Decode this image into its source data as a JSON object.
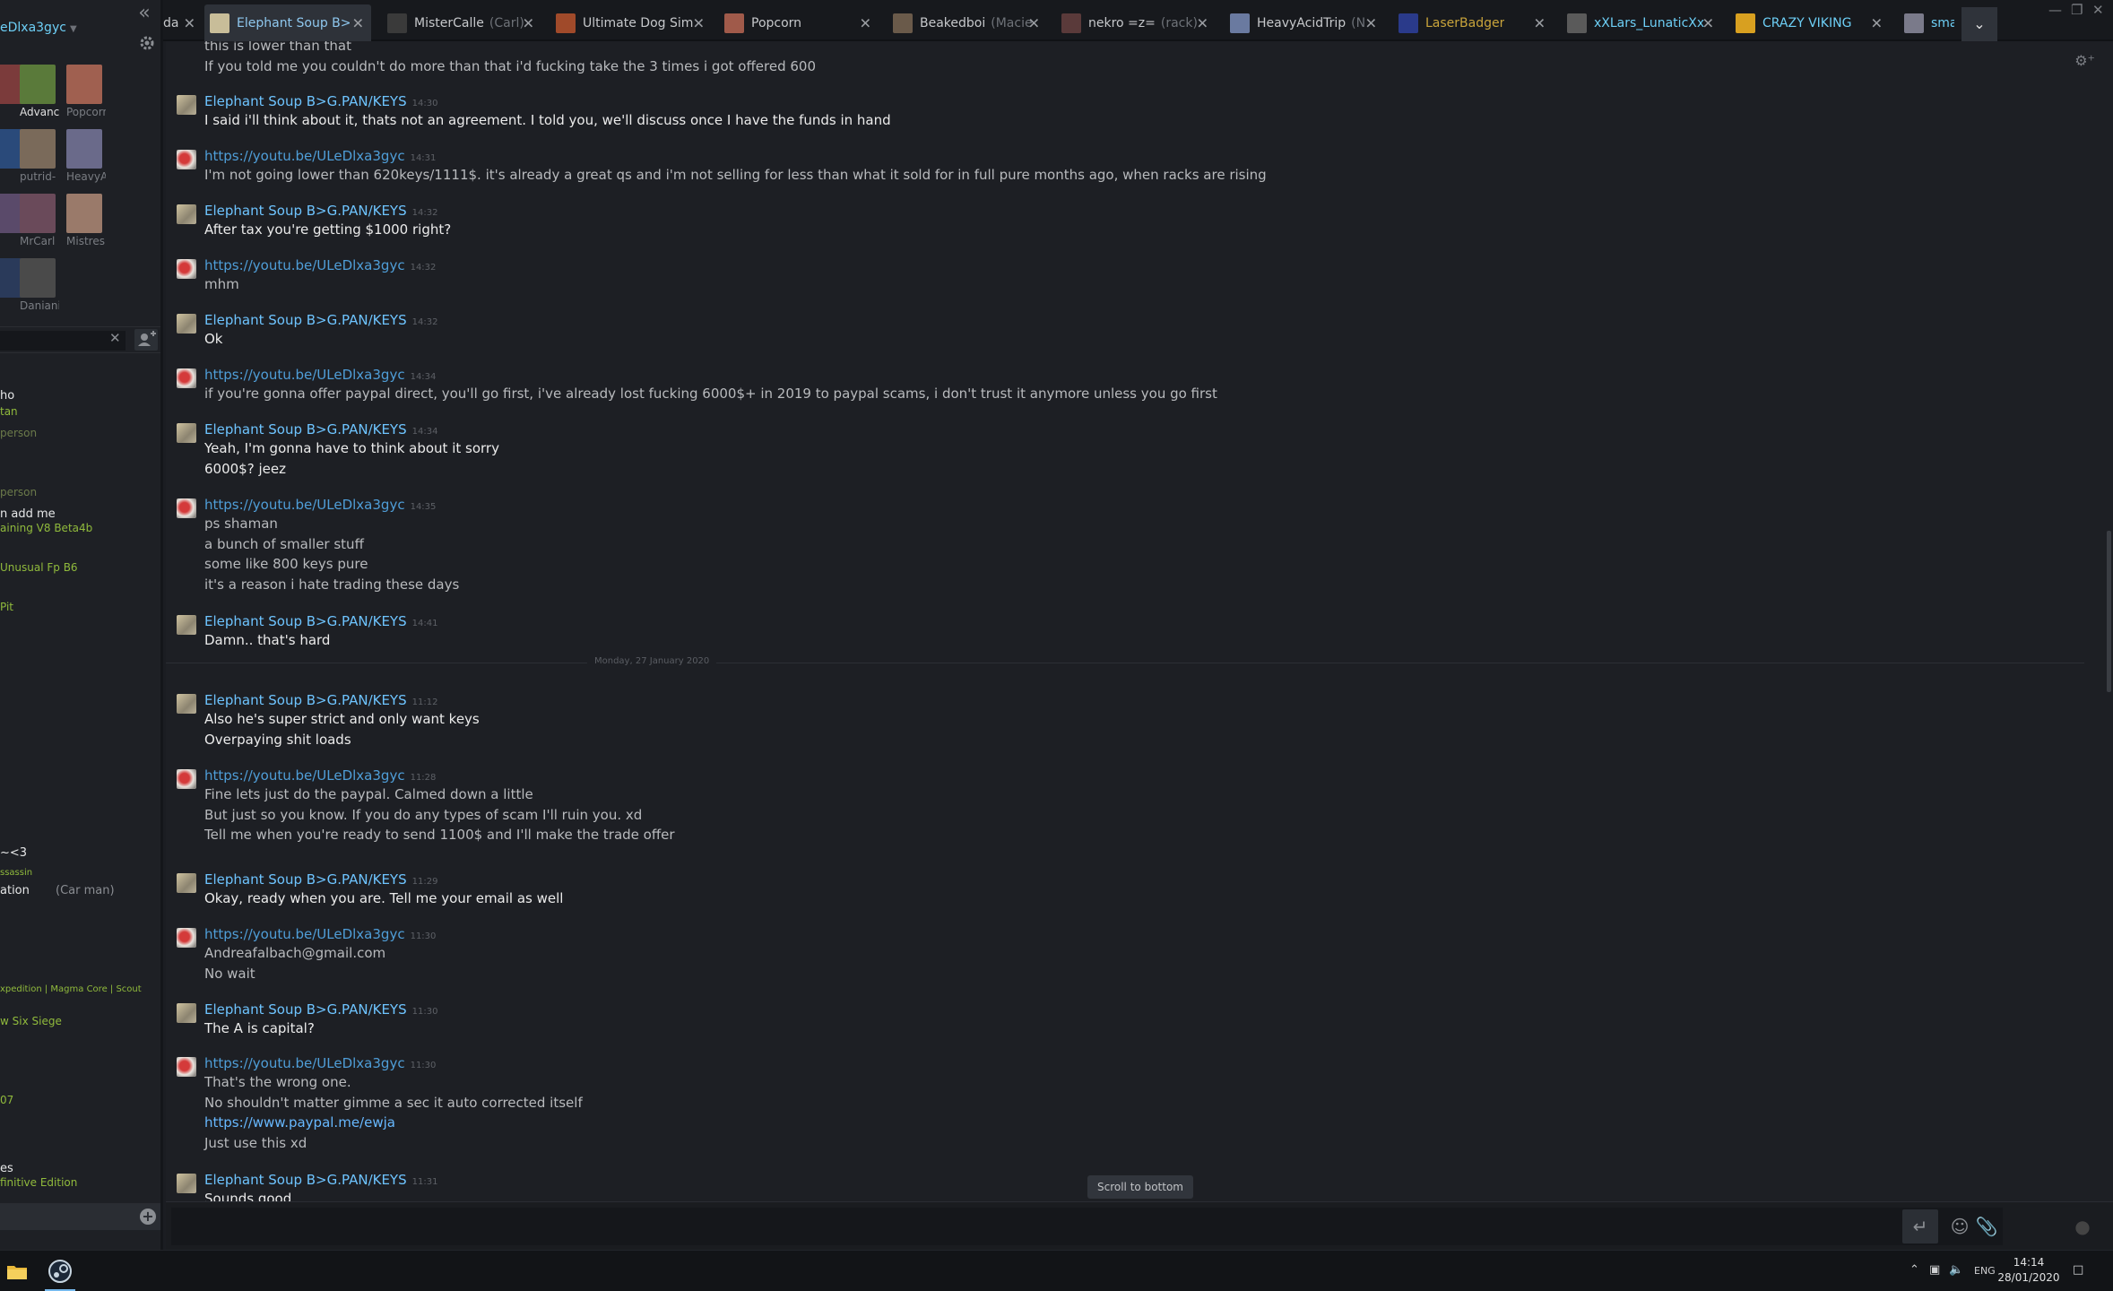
{
  "sidebar": {
    "username": "eDlxa3gyc",
    "group_tiles": [
      {
        "label": "",
        "color": "#7b3b3b"
      },
      {
        "label": "Advanc",
        "color": "#5a7a3a"
      },
      {
        "label": "Popcorn",
        "color": "#a06050"
      },
      {
        "label": "",
        "color": "#2a4a7a"
      },
      {
        "label": "putrid-",
        "color": "#7a6a5a"
      },
      {
        "label": "HeavyA",
        "color": "#6a6a8a"
      },
      {
        "label": "",
        "color": "#5a4a6a"
      },
      {
        "label": "MrCarl",
        "color": "#6a4a5a"
      },
      {
        "label": "Mistres",
        "color": "#9a7a6a"
      },
      {
        "label": "",
        "color": "#2a3a5a"
      },
      {
        "label": "Daniani",
        "color": "#4a4a4a"
      }
    ],
    "friends": [
      {
        "text": "ho",
        "style": "fl-white"
      },
      {
        "text": "tan",
        "style": "fl-green"
      },
      {
        "text": "person",
        "style": "fl-grey"
      },
      {
        "text": "person",
        "style": "fl-grey"
      },
      {
        "text": "n add me",
        "style": "fl-white"
      },
      {
        "text": "aining V8 Beta4b",
        "style": "fl-green"
      },
      {
        "text": "Unusual Fp B6",
        "style": "fl-green"
      },
      {
        "text": "Pit",
        "style": "fl-green"
      },
      {
        "text": "~<3",
        "style": "fl-white"
      },
      {
        "text": "ssassin",
        "style": "fl-small"
      },
      {
        "text": "ation",
        "style": "fl-white"
      },
      {
        "text": "(Car man)",
        "style": "fl-muted"
      },
      {
        "text": "xpedition | Magma Core | Scout",
        "style": "fl-small"
      },
      {
        "text": "w Six Siege",
        "style": "fl-green"
      },
      {
        "text": "07",
        "style": "fl-green"
      },
      {
        "text": "es",
        "style": "fl-white"
      },
      {
        "text": "finitive Edition",
        "style": "fl-green"
      }
    ]
  },
  "tabs": [
    {
      "name": "da",
      "nick": "",
      "color": "#555",
      "active": false
    },
    {
      "name": "Elephant Soup B>",
      "nick": "",
      "color": "#c8bd99",
      "active": true
    },
    {
      "name": "MisterCalle",
      "nick": "(Carl)",
      "color": "#3a3a3a",
      "active": false
    },
    {
      "name": "Ultimate Dog Sim",
      "nick": "",
      "color": "#a04a2a",
      "active": false
    },
    {
      "name": "Popcorn",
      "nick": "",
      "color": "#a05a4a",
      "active": false
    },
    {
      "name": "Beakedboi",
      "nick": "(Macie",
      "color": "#6a5a4a",
      "active": false
    },
    {
      "name": "nekro =z=",
      "nick": "(rack)",
      "color": "#5a3a3a",
      "active": false
    },
    {
      "name": "HeavyAcidTrip",
      "nick": "(N",
      "color": "#6a7aa0",
      "active": false
    },
    {
      "name": "LaserBadger",
      "nick": "",
      "color": "#2a3a8a",
      "active": false,
      "gold": true
    },
    {
      "name": "xXLars_LunaticXx",
      "nick": "",
      "color": "#5a5a5a",
      "active": false,
      "blue": true
    },
    {
      "name": "CRAZY VIKING",
      "nick": "",
      "color": "#d8a020",
      "active": false,
      "blue": true
    },
    {
      "name": "sma",
      "nick": "",
      "color": "#7a7a8a",
      "active": false,
      "blue": true
    }
  ],
  "chat": {
    "date_divider": "Monday, 27 January 2020",
    "scroll_to_bottom": "Scroll to bottom",
    "top_lines": [
      "this is lower than that",
      "If you told me you couldn't do more than that i'd fucking take the 3 times i got offered 600"
    ],
    "messages": [
      {
        "who": "me",
        "sender": "Elephant Soup B>G.PAN/KEYS",
        "time": "14:30",
        "lines": [
          "I said i'll think about it, thats not an agreement. I told you, we'll discuss once I have the funds in hand"
        ]
      },
      {
        "who": "them",
        "sender": "https://youtu.be/ULeDlxa3gyc",
        "time": "14:31",
        "lines": [
          "I'm not going lower than 620keys/1111$. it's already a great qs and i'm not selling for less than what it sold for in full pure months ago, when racks are rising"
        ]
      },
      {
        "who": "me",
        "sender": "Elephant Soup B>G.PAN/KEYS",
        "time": "14:32",
        "lines": [
          "After tax you're getting $1000 right?"
        ]
      },
      {
        "who": "them",
        "sender": "https://youtu.be/ULeDlxa3gyc",
        "time": "14:32",
        "lines": [
          "mhm"
        ]
      },
      {
        "who": "me",
        "sender": "Elephant Soup B>G.PAN/KEYS",
        "time": "14:32",
        "lines": [
          "Ok"
        ]
      },
      {
        "who": "them",
        "sender": "https://youtu.be/ULeDlxa3gyc",
        "time": "14:34",
        "lines": [
          "if you're gonna offer paypal direct, you'll go first, i've already lost fucking 6000$+ in 2019 to paypal scams, i don't trust it anymore unless you go first"
        ]
      },
      {
        "who": "me",
        "sender": "Elephant Soup B>G.PAN/KEYS",
        "time": "14:34",
        "lines": [
          "Yeah, I'm gonna have to think about it sorry",
          "6000$? jeez"
        ]
      },
      {
        "who": "them",
        "sender": "https://youtu.be/ULeDlxa3gyc",
        "time": "14:35",
        "lines": [
          "ps shaman",
          "a bunch of smaller stuff",
          "some like 800 keys pure",
          "it's a reason i hate trading these days"
        ]
      },
      {
        "who": "me",
        "sender": "Elephant Soup B>G.PAN/KEYS",
        "time": "14:41",
        "lines": [
          "Damn.. that's hard"
        ]
      },
      {
        "who": "me",
        "sender": "Elephant Soup B>G.PAN/KEYS",
        "time": "11:12",
        "lines": [
          "Also he's super strict and only want keys",
          "Overpaying shit loads"
        ]
      },
      {
        "who": "them",
        "sender": "https://youtu.be/ULeDlxa3gyc",
        "time": "11:28",
        "lines": [
          "Fine lets just do the paypal. Calmed down a little",
          "But just so you know. If you do any types of scam I'll ruin you. xd",
          "Tell me when you're ready to send 1100$ and I'll make the trade offer"
        ]
      },
      {
        "who": "me",
        "sender": "Elephant Soup B>G.PAN/KEYS",
        "time": "11:29",
        "lines": [
          "Okay, ready when you are. Tell me your email as well"
        ]
      },
      {
        "who": "them",
        "sender": "https://youtu.be/ULeDlxa3gyc",
        "time": "11:30",
        "lines": [
          "Andreafalbach@gmail.com",
          "No wait"
        ]
      },
      {
        "who": "me",
        "sender": "Elephant Soup B>G.PAN/KEYS",
        "time": "11:30",
        "lines": [
          "The A is capital?"
        ]
      },
      {
        "who": "them",
        "sender": "https://youtu.be/ULeDlxa3gyc",
        "time": "11:30",
        "lines": [
          "That's the wrong one.",
          "No shouldn't matter gimme a sec it auto corrected itself",
          "https://www.paypal.me/ewja",
          "Just use this xd"
        ]
      },
      {
        "who": "me",
        "sender": "Elephant Soup B>G.PAN/KEYS",
        "time": "11:31",
        "lines": [
          "Sounds good"
        ]
      }
    ]
  },
  "taskbar": {
    "lang": "ENG",
    "time": "14:14",
    "date": "28/01/2020"
  }
}
